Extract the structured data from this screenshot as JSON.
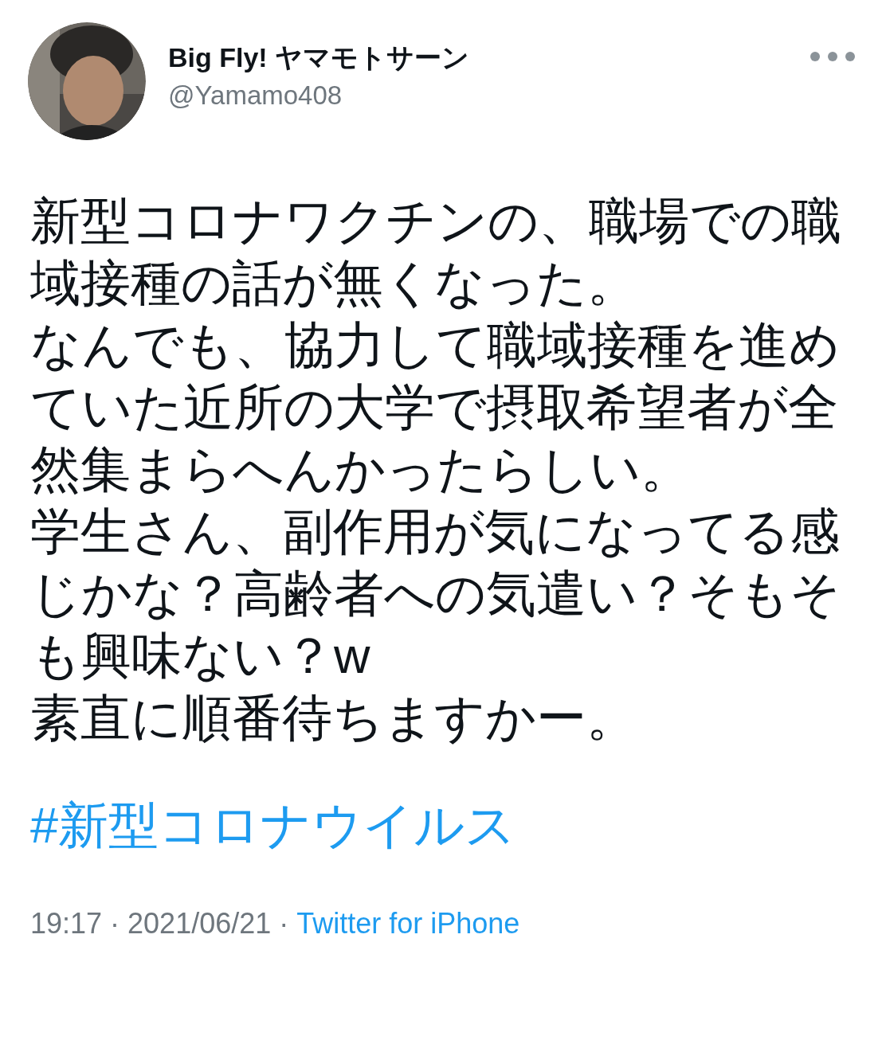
{
  "author": {
    "name": "Big Fly! ヤマモトサーン",
    "handle": "@Yamamo408"
  },
  "tweet": {
    "paragraphs": [
      "新型コロナワクチンの、職場での職域接種の話が無くなった。",
      "なんでも、協力して職域接種を進めていた近所の大学で摂取希望者が全然集まらへんかったらしい。",
      "学生さん、副作用が気になってる感じかな？高齢者への気遣い？そもそも興味ない？w",
      "素直に順番待ちますかー。"
    ],
    "hashtag": "#新型コロナウイルス"
  },
  "meta": {
    "timestamp": "19:17 · 2021/06/21 ·",
    "source": "Twitter for iPhone"
  }
}
